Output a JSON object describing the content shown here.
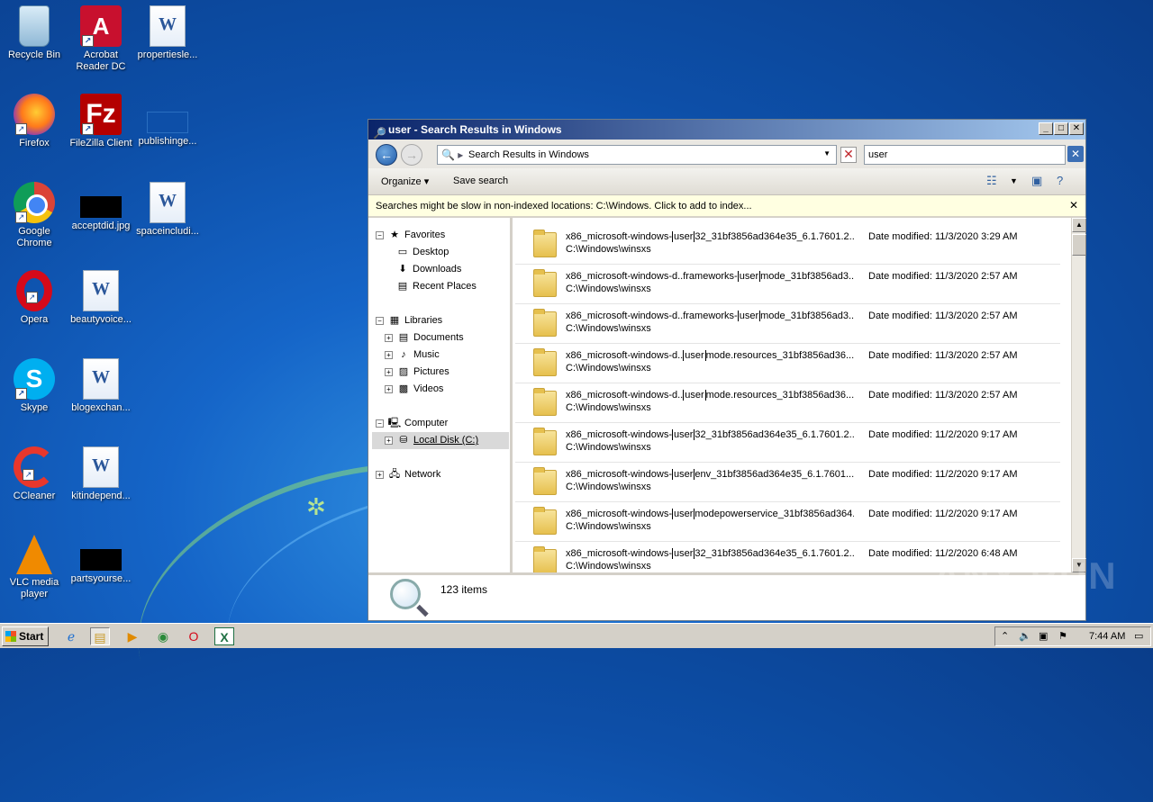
{
  "desktop": {
    "icons": [
      {
        "label": "Recycle Bin"
      },
      {
        "label": "Acrobat Reader DC",
        "glyph": "A"
      },
      {
        "label": "propertiesle...",
        "glyph": "W"
      },
      {
        "label": "Firefox"
      },
      {
        "label": "FileZilla Client",
        "glyph": "Fz"
      },
      {
        "label": "publishinge..."
      },
      {
        "label": "Google Chrome"
      },
      {
        "label": "acceptdid.jpg"
      },
      {
        "label": "spaceincludi...",
        "glyph": "W"
      },
      {
        "label": "Opera"
      },
      {
        "label": "beautyvoice...",
        "glyph": "W"
      },
      {
        "label": "Skype",
        "glyph": "S"
      },
      {
        "label": "blogexchan...",
        "glyph": "W"
      },
      {
        "label": "CCleaner"
      },
      {
        "label": "kitindepend...",
        "glyph": "W"
      },
      {
        "label": "VLC media player"
      },
      {
        "label": "partsyourse..."
      }
    ]
  },
  "window": {
    "title": "user - Search Results in Windows",
    "address": "Search Results in Windows",
    "search_value": "user",
    "toolbar": {
      "organize": "Organize",
      "save_search": "Save search"
    },
    "info_message": "Searches might be slow in non-indexed locations: C:\\Windows. Click to add to index...",
    "nav": {
      "favorites": "Favorites",
      "desktop": "Desktop",
      "downloads": "Downloads",
      "recent": "Recent Places",
      "libraries": "Libraries",
      "documents": "Documents",
      "music": "Music",
      "pictures": "Pictures",
      "videos": "Videos",
      "computer": "Computer",
      "local_disk": "Local Disk (C:)",
      "network": "Network"
    },
    "results": [
      {
        "pre": "x86_microsoft-windows-",
        "hl": "user",
        "post": "32_31bf3856ad364e35_6.1.7601.2...",
        "path": "C:\\Windows\\winsxs",
        "date": "Date modified: 11/3/2020 3:29 AM"
      },
      {
        "pre": "x86_microsoft-windows-d..frameworks-",
        "hl": "user",
        "post": "mode_31bf3856ad3...",
        "path": "C:\\Windows\\winsxs",
        "date": "Date modified: 11/3/2020 2:57 AM"
      },
      {
        "pre": "x86_microsoft-windows-d..frameworks-",
        "hl": "user",
        "post": "mode_31bf3856ad3...",
        "path": "C:\\Windows\\winsxs",
        "date": "Date modified: 11/3/2020 2:57 AM"
      },
      {
        "pre": "x86_microsoft-windows-d..",
        "hl": "user",
        "post": "mode.resources_31bf3856ad36...",
        "path": "C:\\Windows\\winsxs",
        "date": "Date modified: 11/3/2020 2:57 AM"
      },
      {
        "pre": "x86_microsoft-windows-d..",
        "hl": "user",
        "post": "mode.resources_31bf3856ad36...",
        "path": "C:\\Windows\\winsxs",
        "date": "Date modified: 11/3/2020 2:57 AM"
      },
      {
        "pre": "x86_microsoft-windows-",
        "hl": "user",
        "post": "32_31bf3856ad364e35_6.1.7601.2...",
        "path": "C:\\Windows\\winsxs",
        "date": "Date modified: 11/2/2020 9:17 AM"
      },
      {
        "pre": "x86_microsoft-windows-",
        "hl": "user",
        "post": "env_31bf3856ad364e35_6.1.7601....",
        "path": "C:\\Windows\\winsxs",
        "date": "Date modified: 11/2/2020 9:17 AM"
      },
      {
        "pre": "x86_microsoft-windows-",
        "hl": "user",
        "post": "modepowerservice_31bf3856ad364...",
        "path": "C:\\Windows\\winsxs",
        "date": "Date modified: 11/2/2020 9:17 AM"
      },
      {
        "pre": "x86_microsoft-windows-",
        "hl": "user",
        "post": "32_31bf3856ad364e35_6.1.7601.2...",
        "path": "C:\\Windows\\winsxs",
        "date": "Date modified: 11/2/2020 6:48 AM"
      }
    ],
    "item_count": "123 items"
  },
  "taskbar": {
    "start_label": "Start",
    "clock": "7:44 AM"
  },
  "watermark": "ANY RUN",
  "colors": {
    "title_start": "#0a246a",
    "title_end": "#a6caf0",
    "info_bg": "#ffffe1"
  }
}
